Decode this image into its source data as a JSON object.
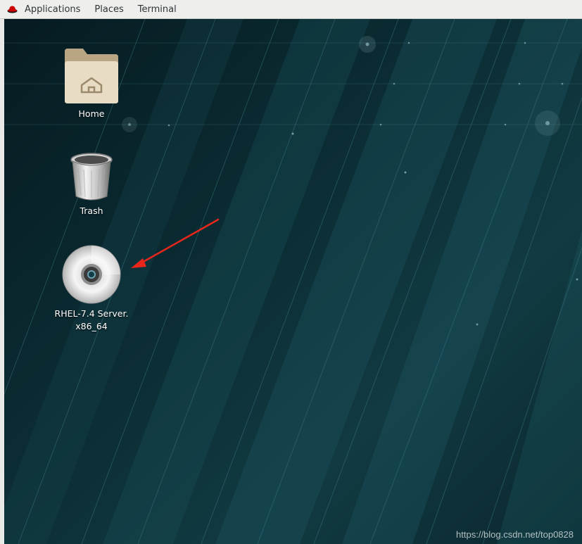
{
  "topbar": {
    "logo_icon": "redhat-logo-icon",
    "menu": [
      {
        "label": "Applications"
      },
      {
        "label": "Places"
      },
      {
        "label": "Terminal"
      }
    ]
  },
  "desktop": {
    "icons": [
      {
        "label": "Home",
        "icon": "home-folder-icon"
      },
      {
        "label": "Trash",
        "icon": "trash-icon"
      },
      {
        "label_line1": "RHEL-7.4 Server.",
        "label_line2": "x86_64",
        "icon": "optical-disc-icon"
      }
    ],
    "annotation": {
      "icon": "red-arrow-icon",
      "color": "#e8261c"
    }
  },
  "watermark": "https://blog.csdn.net/top0828"
}
